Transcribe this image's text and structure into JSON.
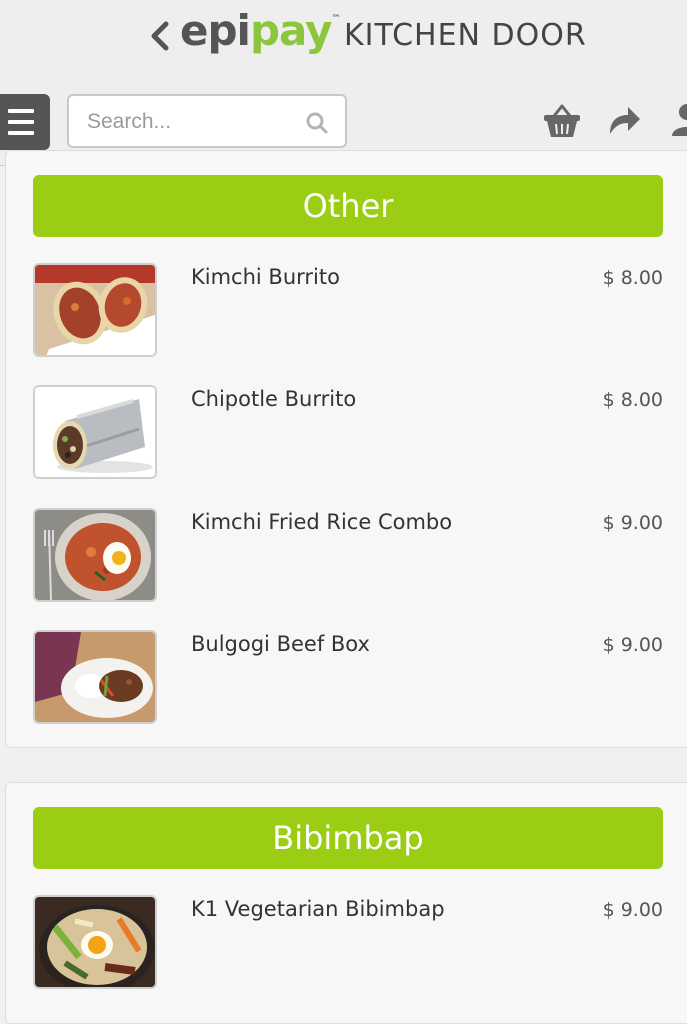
{
  "header": {
    "logo_part1": "epi",
    "logo_part2": "pay",
    "logo_tm": "™",
    "store_name": "KITCHEN DOOR"
  },
  "search": {
    "placeholder": "Search..."
  },
  "icons": {
    "back": "chevron-left-icon",
    "menu": "hamburger-menu-icon",
    "search": "search-icon",
    "basket": "basket-icon",
    "share": "share-arrow-icon",
    "user": "user-icon"
  },
  "colors": {
    "accent": "#9acd13",
    "logo_green": "#8cc63f"
  },
  "sections": [
    {
      "title": "Other",
      "items": [
        {
          "name": "Kimchi Burrito",
          "price": "$ 8.00"
        },
        {
          "name": "Chipotle Burrito",
          "price": "$ 8.00"
        },
        {
          "name": "Kimchi Fried Rice Combo",
          "price": "$ 9.00"
        },
        {
          "name": "Bulgogi Beef Box",
          "price": "$ 9.00"
        }
      ]
    },
    {
      "title": "Bibimbap",
      "items": [
        {
          "name": "K1 Vegetarian Bibimbap",
          "price": "$ 9.00"
        }
      ]
    }
  ]
}
